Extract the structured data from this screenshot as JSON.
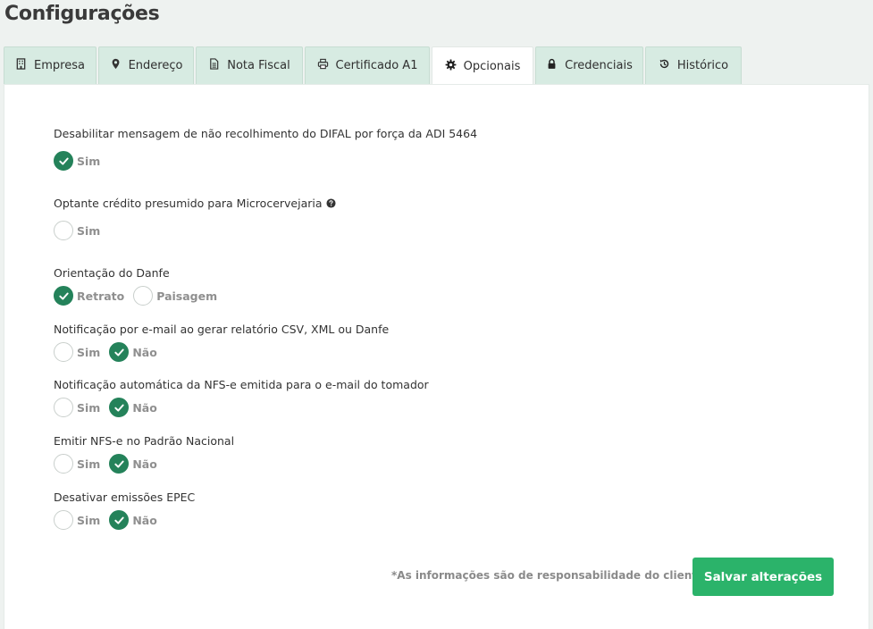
{
  "page": {
    "title": "Configurações"
  },
  "tabs": [
    {
      "label": "Empresa",
      "icon": "building-icon",
      "active": false
    },
    {
      "label": "Endereço",
      "icon": "map-marker-icon",
      "active": false
    },
    {
      "label": "Nota Fiscal",
      "icon": "document-icon",
      "active": false
    },
    {
      "label": "Certificado A1",
      "icon": "printer-icon",
      "active": false
    },
    {
      "label": "Opcionais",
      "icon": "gear-icon",
      "active": true
    },
    {
      "label": "Credenciais",
      "icon": "lock-icon",
      "active": false
    },
    {
      "label": "Histórico",
      "icon": "history-icon",
      "active": false
    }
  ],
  "options": [
    {
      "label": "Desabilitar mensagem de não recolhimento do DIFAL por força da ADI 5464",
      "choices": [
        {
          "label": "Sim",
          "checked": true
        }
      ]
    },
    {
      "label": "Optante crédito presumido para Microcervejaria",
      "help_icon": "question-circle-icon",
      "choices": [
        {
          "label": "Sim",
          "checked": false
        }
      ]
    },
    {
      "label": "Orientação do Danfe",
      "choices": [
        {
          "label": "Retrato",
          "checked": true
        },
        {
          "label": "Paisagem",
          "checked": false
        }
      ]
    },
    {
      "label": "Notificação por e-mail ao gerar relatório CSV, XML ou Danfe",
      "choices": [
        {
          "label": "Sim",
          "checked": false
        },
        {
          "label": "Não",
          "checked": true
        }
      ]
    },
    {
      "label": "Notificação automática da NFS-e emitida para o e-mail do tomador",
      "choices": [
        {
          "label": "Sim",
          "checked": false
        },
        {
          "label": "Não",
          "checked": true
        }
      ]
    },
    {
      "label": "Emitir NFS-e no Padrão Nacional",
      "choices": [
        {
          "label": "Sim",
          "checked": false
        },
        {
          "label": "Não",
          "checked": true
        }
      ]
    },
    {
      "label": "Desativar emissões EPEC",
      "choices": [
        {
          "label": "Sim",
          "checked": false
        },
        {
          "label": "Não",
          "checked": true
        }
      ]
    }
  ],
  "footer": {
    "disclaimer": "*As informações são de responsabilidade do cliente.",
    "save_label": "Salvar alterações"
  },
  "colors": {
    "accent": "#24825a",
    "save_button": "#2bb36a",
    "tab_background": "#d7ebe2"
  }
}
